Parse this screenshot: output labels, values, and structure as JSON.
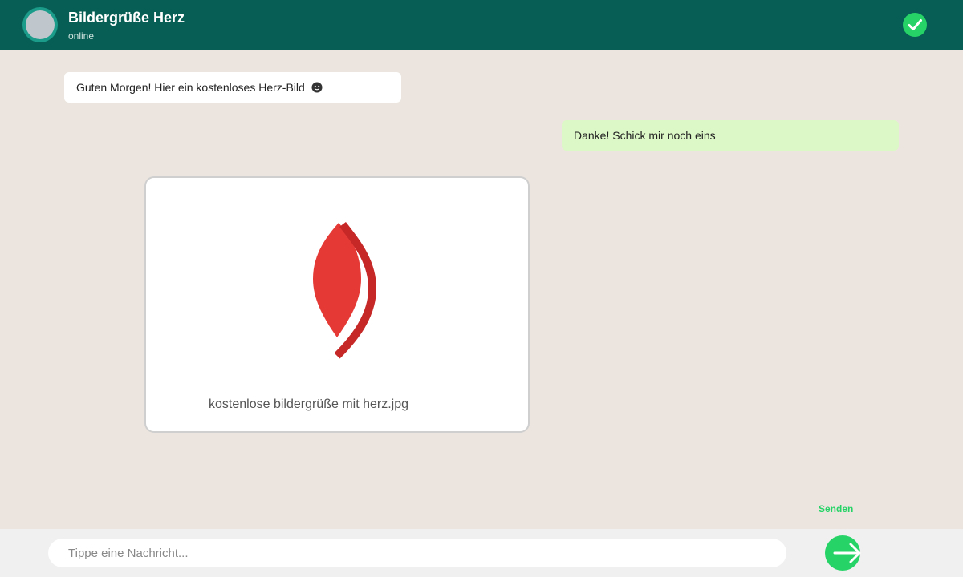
{
  "header": {
    "title": "Bildergrüße Herz",
    "status": "online",
    "verified_icon": "check-circle-icon",
    "colors": {
      "bar": "#075e54",
      "accent": "#25d366"
    }
  },
  "messages": [
    {
      "direction": "incoming",
      "text": "Guten Morgen! Hier ein kostenloses Herz-Bild",
      "emoji_icon": "smiley-icon"
    },
    {
      "direction": "outgoing",
      "text": "Danke! Schick mir noch eins"
    }
  ],
  "image_message": {
    "icon": "heart-leaf-icon",
    "file_name": "kostenlose bildergrüße mit herz.jpg",
    "colors": {
      "fill": "#e53935",
      "stroke": "#c62828"
    }
  },
  "composer": {
    "placeholder": "Tippe eine Nachricht...",
    "send_label": "Senden",
    "send_icon": "arrow-right-icon"
  }
}
